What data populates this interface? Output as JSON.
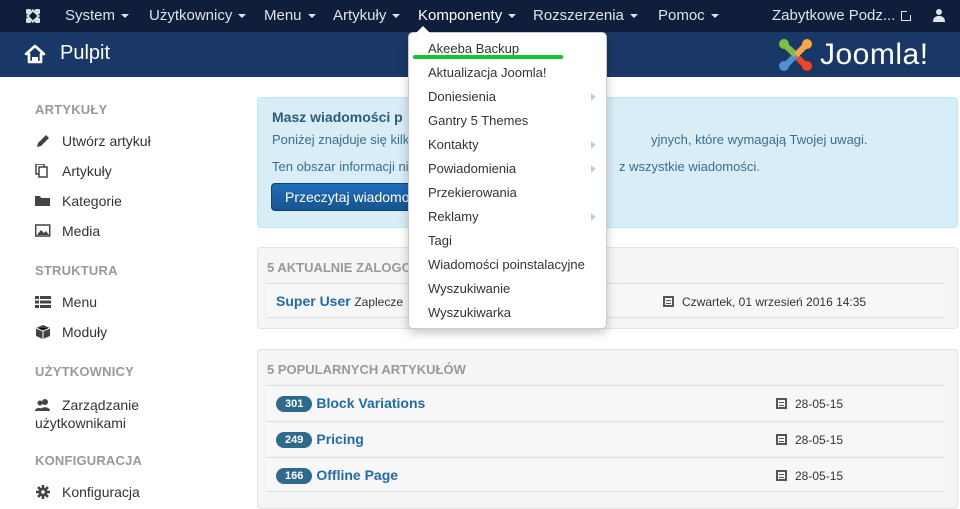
{
  "topbar": {
    "logo_icon": "joomla-icon",
    "menus": [
      {
        "label": "System",
        "active": false
      },
      {
        "label": "Użytkownicy",
        "active": false
      },
      {
        "label": "Menu",
        "active": false
      },
      {
        "label": "Artykuły",
        "active": false
      },
      {
        "label": "Komponenty",
        "active": true
      },
      {
        "label": "Rozszerzenia",
        "active": false
      },
      {
        "label": "Pomoc",
        "active": false
      }
    ],
    "site_link": "Zabytkowe Podz...",
    "site_link_icon": "external-link-icon",
    "user_icon": "user-icon"
  },
  "header": {
    "title": "Pulpit",
    "icon": "home-icon",
    "brand": "Joomla!"
  },
  "sidebar": {
    "sections": [
      {
        "title": "ARTYKUŁY",
        "items": [
          {
            "label": "Utwórz artykuł",
            "icon": "pencil-icon"
          },
          {
            "label": "Artykuły",
            "icon": "stack-icon"
          },
          {
            "label": "Kategorie",
            "icon": "folder-icon"
          },
          {
            "label": "Media",
            "icon": "image-icon"
          }
        ]
      },
      {
        "title": "STRUKTURA",
        "items": [
          {
            "label": "Menu",
            "icon": "list-icon"
          },
          {
            "label": "Moduły",
            "icon": "cube-icon"
          }
        ]
      },
      {
        "title": "UŻYTKOWNICY",
        "items": [
          {
            "label": "Zarządzanie",
            "label2": "użytkownikami",
            "icon": "users-icon"
          }
        ]
      },
      {
        "title": "KONFIGURACJA",
        "items": [
          {
            "label": "Konfiguracja",
            "icon": "gear-icon"
          }
        ]
      }
    ]
  },
  "alert": {
    "title": "Masz wiadomości p",
    "line1_left": "Poniżej znajduje się kilk",
    "line1_right": "yjnych, które wymagają Twojej uwagi.",
    "line2_left": "Ten obszar informacji ni",
    "line2_right": "z wszystkie wiadomości.",
    "button": "Przeczytaj wiadomości"
  },
  "logged_users": {
    "title": "5 AKTUALNIE ZALOGO",
    "rows": [
      {
        "user": "Super User",
        "area": "Zaplecze",
        "date": "Czwartek, 01 wrzesień 2016 14:35"
      }
    ]
  },
  "popular": {
    "title": "5 POPULARNYCH ARTYKUŁÓW",
    "rows": [
      {
        "hits": "301",
        "title": "Block Variations",
        "date": "28-05-15"
      },
      {
        "hits": "249",
        "title": "Pricing",
        "date": "28-05-15"
      },
      {
        "hits": "166",
        "title": "Offline Page",
        "date": "28-05-15"
      }
    ]
  },
  "dropdown": {
    "items": [
      {
        "label": "Akeeba Backup",
        "submenu": false
      },
      {
        "label": "Aktualizacja Joomla!",
        "submenu": false
      },
      {
        "label": "Doniesienia",
        "submenu": true
      },
      {
        "label": "Gantry 5 Themes",
        "submenu": false
      },
      {
        "label": "Kontakty",
        "submenu": true
      },
      {
        "label": "Powiadomienia",
        "submenu": true
      },
      {
        "label": "Przekierowania",
        "submenu": false
      },
      {
        "label": "Reklamy",
        "submenu": true
      },
      {
        "label": "Tagi",
        "submenu": false
      },
      {
        "label": "Wiadomości poinstalacyjne",
        "submenu": false
      },
      {
        "label": "Wyszukiwanie",
        "submenu": false
      },
      {
        "label": "Wyszukiwarka",
        "submenu": false
      }
    ],
    "highlight_color": "#14c431"
  },
  "colors": {
    "topbar": "#0f1e3a",
    "header": "#1a3867",
    "link": "#226baa",
    "badge": "#2e6a8c",
    "alert_bg": "#d9edf7"
  }
}
